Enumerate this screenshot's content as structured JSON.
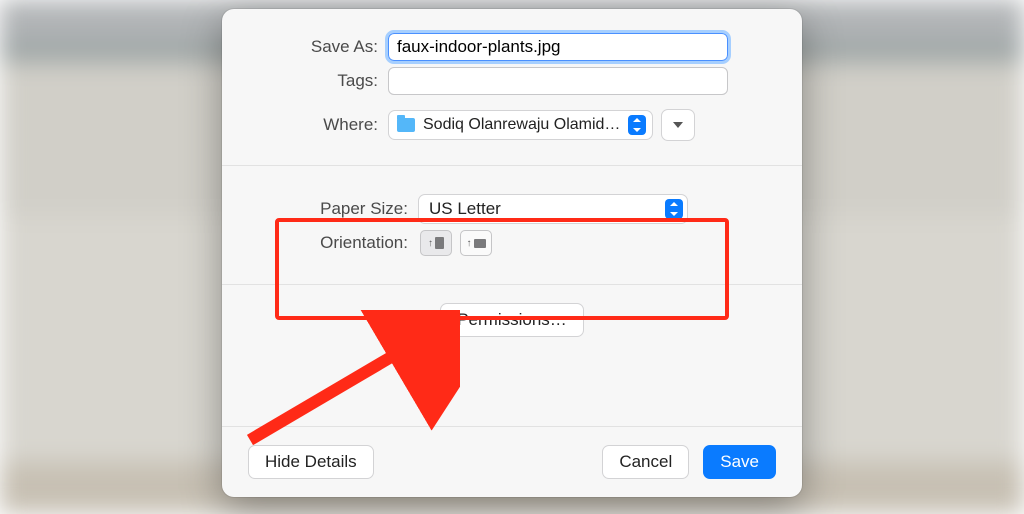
{
  "labels": {
    "save_as": "Save As:",
    "tags": "Tags:",
    "where": "Where:",
    "paper_size": "Paper Size:",
    "orientation": "Orientation:"
  },
  "filename": "faux-indoor-plants.jpg",
  "tags_value": "",
  "where_folder": "Sodiq Olanrewaju Olamid…",
  "paper_size_value": "US Letter",
  "permissions_label": "Permissions…",
  "footer": {
    "hide_details": "Hide Details",
    "cancel": "Cancel",
    "save": "Save"
  }
}
